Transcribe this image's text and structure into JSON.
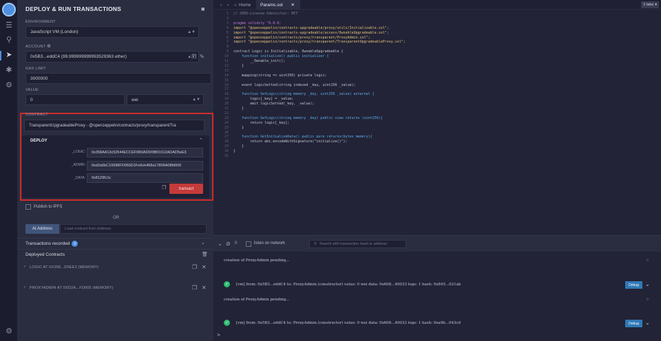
{
  "panel": {
    "title": "DEPLOY & RUN TRANSACTIONS",
    "environment_label": "ENVIRONMENT",
    "environment_value": "JavaScript VM (London)",
    "account_label": "ACCOUNT",
    "account_value": "0x5B3...eddC4 (99.999999999993529363 ether)",
    "gas_limit_label": "GAS LIMIT",
    "gas_limit_value": "3000000",
    "value_label": "VALUE",
    "value_amount": "0",
    "value_unit": "wei",
    "contract_label": "CONTRACT",
    "contract_value": "TransparentUpgradeableProxy - @openzeppelin/contracts/proxy/transparent/Tra",
    "deploy_label": "DEPLOY",
    "params": [
      {
        "name": "_LOGIC:",
        "value": "0x358AA13c52544ECCEF6B0ADD0f801012ADAD5eE3"
      },
      {
        "name": "_ADMIN:",
        "value": "0xd2a5bC10698FD955D1Fe6cb468a17809A08fd005"
      },
      {
        "name": "_DATA:",
        "value": "0x8129fc1c"
      }
    ],
    "transact_label": "transact",
    "publish_label": "Publish to IPFS",
    "or_label": "OR",
    "at_address_label": "At Address",
    "load_contract_placeholder": "Load contract from Address",
    "transactions_recorded_label": "Transactions recorded",
    "transactions_recorded_count": "3",
    "deployed_contracts_label": "Deployed Contracts",
    "deployed": [
      {
        "label": "LOGIC AT 0X358...D5EE3 (MEMORY)"
      },
      {
        "label": "PROXYADMIN AT 0XD2A...FD005 (MEMORY)"
      }
    ]
  },
  "tabs": {
    "home": "Home",
    "file": "Params.sol",
    "count": "2 tabs"
  },
  "editor": {
    "lines": [
      {
        "n": "1",
        "t": "// SPDX-License-Identifier: MIT",
        "k": "cmt"
      },
      {
        "n": "2",
        "t": "",
        "k": ""
      },
      {
        "n": "3",
        "t": "pragma solidity ^0.8.0;",
        "k": "kw"
      },
      {
        "n": "4",
        "t": "import \"@openzeppelin/contracts-upgradeable/proxy/utils/Initializable.sol\";",
        "k": "str"
      },
      {
        "n": "5",
        "t": "import \"@openzeppelin/contracts-upgradeable/access/OwnableUpgradeable.sol\";",
        "k": "str"
      },
      {
        "n": "6",
        "t": "import \"@openzeppelin/contracts/proxy/transparent/ProxyAdmin.sol\";",
        "k": "str"
      },
      {
        "n": "7",
        "t": "import \"@openzeppelin/contracts/proxy/transparent/TransparentUpgradeableProxy.sol\";",
        "k": "str"
      },
      {
        "n": "8",
        "t": "",
        "k": ""
      },
      {
        "n": "9",
        "t": "contract Logic is Initializable, OwnableUpgradeable {",
        "k": ""
      },
      {
        "n": "10",
        "t": "    function initialize() public initializer {",
        "k": "fn"
      },
      {
        "n": "11",
        "t": "        __Ownable_init();",
        "k": ""
      },
      {
        "n": "12",
        "t": "    }",
        "k": ""
      },
      {
        "n": "13",
        "t": "",
        "k": ""
      },
      {
        "n": "14",
        "t": "    mapping(string => uint256) private logic;",
        "k": ""
      },
      {
        "n": "15",
        "t": "",
        "k": ""
      },
      {
        "n": "16",
        "t": "    event logicSetted(string indexed _key, uint256 _value);",
        "k": ""
      },
      {
        "n": "17",
        "t": "",
        "k": ""
      },
      {
        "n": "18",
        "t": "    function SetLogic(string memory _key, uint256 _value) external {",
        "k": "fn"
      },
      {
        "n": "19",
        "t": "        logic[_key] = _value;",
        "k": ""
      },
      {
        "n": "20",
        "t": "        emit logicSetted(_key, _value);",
        "k": ""
      },
      {
        "n": "21",
        "t": "    }",
        "k": ""
      },
      {
        "n": "22",
        "t": "",
        "k": ""
      },
      {
        "n": "23",
        "t": "    function GetLogic(string memory _key) public view returns (uint256){",
        "k": "fn"
      },
      {
        "n": "24",
        "t": "        return logic[_key];",
        "k": ""
      },
      {
        "n": "25",
        "t": "    }",
        "k": ""
      },
      {
        "n": "26",
        "t": "",
        "k": ""
      },
      {
        "n": "27",
        "t": "    function GetInitializeData() public pure returns(bytes memory){",
        "k": "fn"
      },
      {
        "n": "28",
        "t": "        return abi.encodeWithSignature(\"initialize()\");",
        "k": ""
      },
      {
        "n": "29",
        "t": "    }",
        "k": ""
      },
      {
        "n": "30",
        "t": "}",
        "k": ""
      },
      {
        "n": "31",
        "t": "",
        "k": ""
      }
    ]
  },
  "terminal": {
    "zero_count": "0",
    "listen_label": "listen on network",
    "search_placeholder": "Search with transaction hash or address",
    "pending_1": "creation of ProxyAdmin pending...",
    "tx_1": "[vm]  from: 0x5B3...eddC4 to: ProxyAdmin.(constructor) value: 0 wei data: 0x608...40033 logs: 1 hash: 0x845...021ab",
    "pending_2": "creation of ProxyAdmin pending...",
    "tx_2": "[vm]  from: 0x5B3...eddC4 to: ProxyAdmin.(constructor) value: 0 wei data: 0x608...40033 logs: 1 hash: 0xa9b...043cd",
    "debug_label": "Debug",
    "prompt": ">"
  },
  "colors": {
    "accent": "#4d8fe0",
    "transact": "#c53a3a",
    "highlight_frame": "#d12b2b",
    "success": "#2ebc6f",
    "debug": "#3079b6"
  }
}
